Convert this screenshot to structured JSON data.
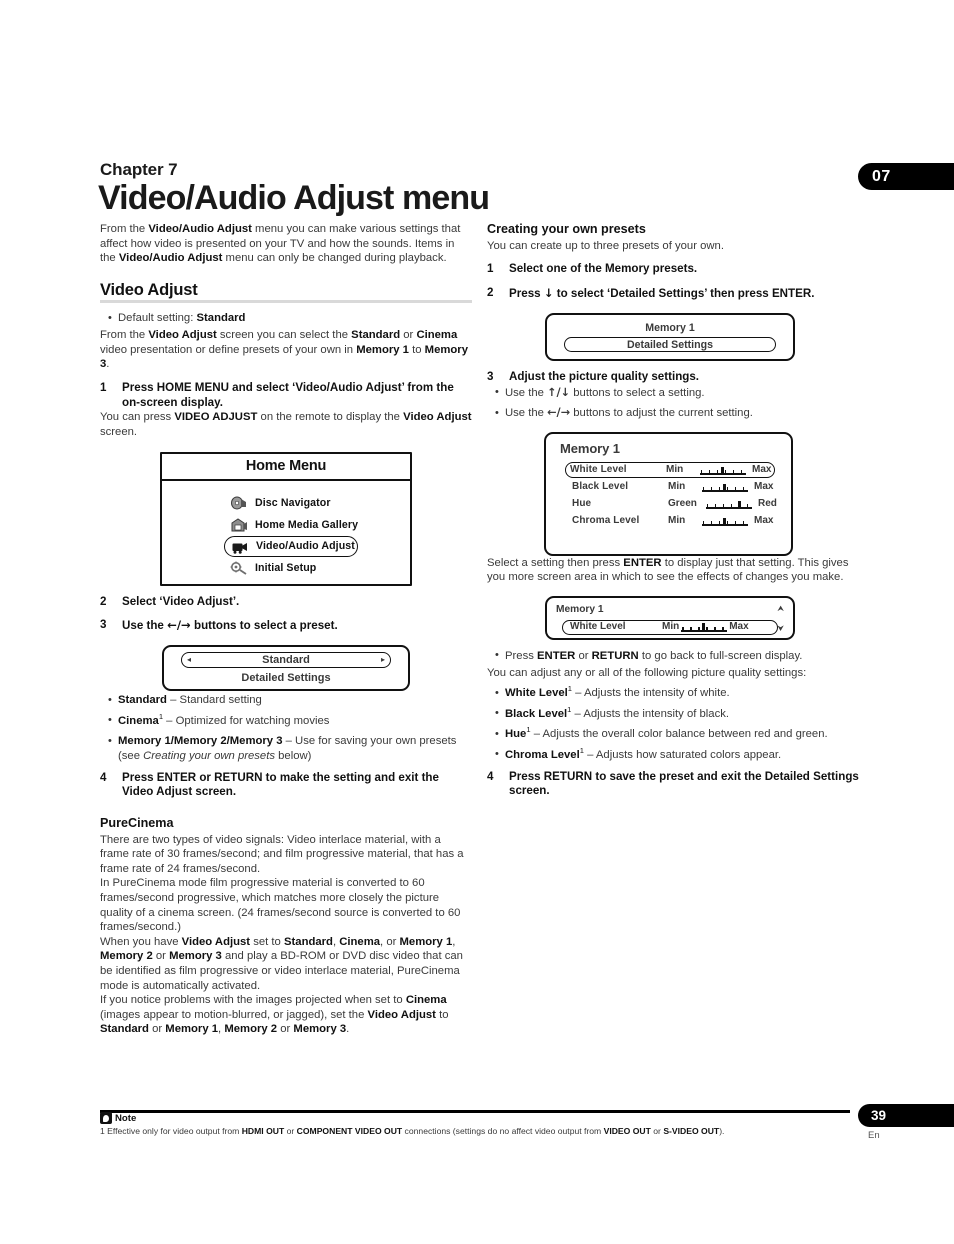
{
  "chapter": {
    "tab_number": "07",
    "label": "Chapter 7",
    "title": "Video/Audio Adjust menu"
  },
  "intro": {
    "p1_a": "From the ",
    "p1_b1": "Video/Audio Adjust",
    "p1_c": " menu you can make various settings that affect how video is presented on your TV and how the sounds. Items in the ",
    "p1_b2": "Video/Audio Adjust",
    "p1_d": " menu can only be changed during playback."
  },
  "video_adjust": {
    "heading": "Video Adjust",
    "default_bullet_a": "Default setting: ",
    "default_bullet_b": "Standard",
    "para_a": "From the ",
    "para_b1": "Video Adjust",
    "para_c": " screen you can select the ",
    "para_b2": "Standard",
    "para_d": " or ",
    "para_b3": "Cinema",
    "para_e": " video presentation or define presets of your own in ",
    "para_b4": "Memory 1",
    "para_f": " to ",
    "para_b5": "Memory 3",
    "para_g": ".",
    "step1_num": "1",
    "step1_text": "Press HOME MENU and select ‘Video/Audio Adjust’ from the on-screen display.",
    "step1_body_a": "You can press ",
    "step1_body_b1": "VIDEO ADJUST",
    "step1_body_c": " on the remote to display the ",
    "step1_body_b2": "Video Adjust",
    "step1_body_d": " screen.",
    "step2_num": "2",
    "step2_text": "Select ‘Video Adjust’.",
    "step3_num": "3",
    "step3_text_a": "Use the ",
    "step3_arrows": "←/→",
    "step3_text_b": " buttons to select a preset.",
    "preset_bullets": [
      {
        "term": "Standard",
        "sup": "",
        "desc": " – Standard setting"
      },
      {
        "term": "Cinema",
        "sup": "1",
        "desc": " – Optimized for watching movies"
      },
      {
        "term": "Memory 1/Memory 2/Memory 3",
        "sup": "",
        "desc_a": " – Use for saving your own presets (see ",
        "desc_i": "Creating your own presets",
        "desc_b": " below)"
      }
    ],
    "step4_num": "4",
    "step4_text": "Press ENTER or RETURN to make the setting and exit the Video Adjust screen."
  },
  "home_menu_osd": {
    "title": "Home Menu",
    "items": [
      {
        "label": "Disc  Navigator",
        "icon": "disc-navigator-icon",
        "selected": false
      },
      {
        "label": "Home Media Gallery",
        "icon": "home-media-gallery-icon",
        "selected": false
      },
      {
        "label": "Video/Audio Adjust",
        "icon": "video-audio-adjust-icon",
        "selected": true
      },
      {
        "label": "Initial Setup",
        "icon": "initial-setup-icon",
        "selected": false
      }
    ]
  },
  "preset_osd": {
    "left_arrow": "◂",
    "value": "Standard",
    "right_arrow": "▸",
    "sub_label": "Detailed Settings"
  },
  "purecinema": {
    "heading": "PureCinema",
    "p1": "There are two types of video signals: Video interlace material, with a frame rate of 30 frames/second; and film progressive material, that has a frame rate of 24 frames/second.",
    "p2": "In PureCinema mode film progressive material is converted to 60 frames/second progressive, which matches more closely the picture quality of a cinema screen. (24 frames/second source is converted to 60 frames/second.)",
    "p3_a": "When you have ",
    "p3_b1": "Video Adjust",
    "p3_c": " set to ",
    "p3_b2": "Standard",
    "p3_d": ", ",
    "p3_b3": "Cinema",
    "p3_e": ", or ",
    "p3_b4": "Memory 1",
    "p3_f": ", ",
    "p3_b5": "Memory 2",
    "p3_g": " or ",
    "p3_b6": "Memory 3",
    "p3_h": " and play a BD-ROM or DVD disc video that can be identified as film progressive or video interlace material, PureCinema mode is automatically activated.",
    "p4_a": "If you notice problems with the images projected when set to ",
    "p4_b1": "Cinema",
    "p4_c": " (images appear to motion-blurred, or jagged), set the ",
    "p4_b2": "Video Adjust",
    "p4_d": " to ",
    "p4_b3": "Standard",
    "p4_e": " or ",
    "p4_b4": "Memory 1",
    "p4_f": ", ",
    "p4_b5": "Memory 2",
    "p4_g": " or ",
    "p4_b6": "Memory 3",
    "p4_h": "."
  },
  "presets_section": {
    "heading": "Creating your own presets",
    "intro": "You can create up to three presets of your own.",
    "step1_num": "1",
    "step1_text": "Select one of the Memory presets.",
    "step2_num": "2",
    "step2_text_a": "Press ",
    "step2_arrow": "↓",
    "step2_text_b": " to select ‘Detailed Settings’ then press ENTER.",
    "memory_osd": {
      "caption": "Memory 1",
      "pill_label": "Detailed Settings"
    },
    "step3_num": "3",
    "step3_text": "Adjust the picture quality settings.",
    "step3_bullet1_a": "Use the ",
    "step3_bullet1_arrows": "↑/↓",
    "step3_bullet1_b": " buttons to select a setting.",
    "step3_bullet2_a": "Use the ",
    "step3_bullet2_arrows": "←/→",
    "step3_bullet2_b": " buttons to adjust the current setting.",
    "settings_osd": {
      "title": "Memory 1",
      "rows": [
        {
          "name": "White  Level",
          "low": "Min",
          "high": "Max",
          "selected": true,
          "knob_pct": 50
        },
        {
          "name": "Black  Level",
          "low": "Min",
          "high": "Max",
          "selected": false,
          "knob_pct": 50
        },
        {
          "name": "Hue",
          "low": "Green",
          "high": "Red",
          "selected": false,
          "knob_pct": 72
        },
        {
          "name": "Chroma Level",
          "low": "Min",
          "high": "Max",
          "selected": false,
          "knob_pct": 50
        }
      ]
    },
    "after_osd_a": "Select a setting then press ",
    "after_osd_b": "ENTER",
    "after_osd_c": " to display just that setting. This gives you more screen area in which to see the effects of changes you make.",
    "compact_osd": {
      "caption": "Memory 1",
      "row_name": "White  Level",
      "low": "Min",
      "high": "Max",
      "scroll_up": "⮝",
      "scroll_down": "⮟"
    },
    "press_bullet_a": "Press ",
    "press_bullet_b1": "ENTER",
    "press_bullet_c": " or ",
    "press_bullet_b2": "RETURN",
    "press_bullet_d": " to go back to full-screen display.",
    "adjust_line": "You can adjust any or all of the following picture quality settings:",
    "quality_bullets": [
      {
        "term": "White Level",
        "sup": "1",
        "desc": " – Adjusts the intensity of white."
      },
      {
        "term": "Black Level",
        "sup": "1",
        "desc": " – Adjusts the intensity of black."
      },
      {
        "term": "Hue",
        "sup": "1",
        "desc": " – Adjusts the overall color balance between red and green."
      },
      {
        "term": "Chroma Level",
        "sup": "1",
        "desc": " – Adjusts how saturated colors appear."
      }
    ],
    "step4_num": "4",
    "step4_text": "Press RETURN to save the preset and exit the Detailed Settings screen."
  },
  "footer": {
    "note_label": "Note",
    "footnote_a": "1 Effective only for video output from ",
    "footnote_b1": "HDMI OUT",
    "footnote_c": " or ",
    "footnote_b2": "COMPONENT VIDEO OUT",
    "footnote_d": " connections (settings do no affect video output from ",
    "footnote_b3": "VIDEO OUT",
    "footnote_e": " or ",
    "footnote_b4": "S-VIDEO OUT",
    "footnote_f": ").",
    "page_number": "39",
    "language": "En"
  }
}
